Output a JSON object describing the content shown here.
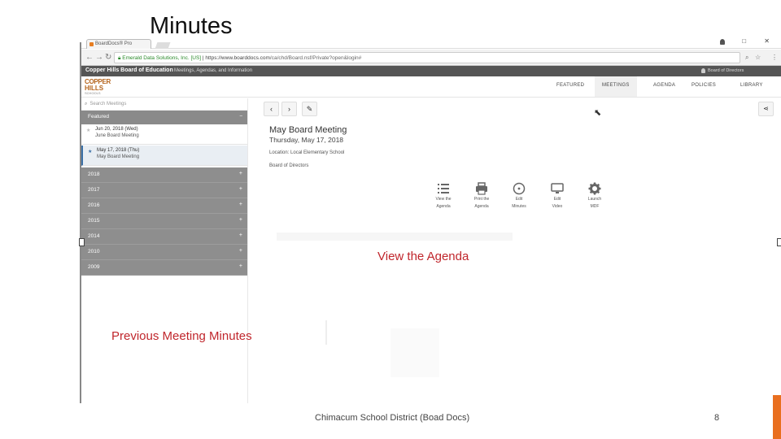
{
  "slide": {
    "title": "Minutes",
    "callout_agenda": "View the Agenda",
    "callout_minutes": "Previous Meeting Minutes",
    "footer": "Chimacum School District (Boad Docs)",
    "page_number": "8",
    "accent_color": "#c0262c",
    "bar_color": "#e96f1f"
  },
  "browser": {
    "tab_label": "BoardDocs® Pro",
    "window_controls": "–  □  ✕",
    "url_secure": "Emerald Data Solutions, Inc. [US]",
    "url_host": "https://www.boarddocs.com",
    "url_path": "/ca/chd/Board.nsf/Private?open&login#"
  },
  "site": {
    "board_title": "Copper Hills Board of Education",
    "subtitle": "Meetings, Agendas, and Information",
    "user_menu": "Board of Directors",
    "logo_line1": "COPPER",
    "logo_line2": "HILLS",
    "logo_line3": "SCHOOLS",
    "nav": [
      "FEATURED",
      "MEETINGS",
      "AGENDA",
      "POLICIES",
      "LIBRARY"
    ]
  },
  "sidebar": {
    "search_placeholder": "Search Meetings",
    "featured_label": "Featured",
    "meetings": [
      {
        "date": "Jun 20, 2018 (Wed)",
        "name": "June Board Meeting",
        "selected": false
      },
      {
        "date": "May 17, 2018 (Thu)",
        "name": "May Board Meeting",
        "selected": true
      }
    ],
    "years": [
      "2018",
      "2017",
      "2016",
      "2015",
      "2014",
      "2010",
      "2009"
    ]
  },
  "meeting": {
    "title": "May Board Meeting",
    "date": "Thursday, May 17, 2018",
    "location": "Location: Local Elementary School",
    "board": "Board of Directors"
  },
  "actions": [
    {
      "line1": "View the",
      "line2": "Agenda",
      "icon": "list-icon"
    },
    {
      "line1": "Print the",
      "line2": "Agenda",
      "icon": "printer-icon"
    },
    {
      "line1": "Edit",
      "line2": "Minutes",
      "icon": "clock-icon"
    },
    {
      "line1": "Edit",
      "line2": "Video",
      "icon": "monitor-icon"
    },
    {
      "line1": "Launch",
      "line2": "MDF",
      "icon": "gear-icon"
    }
  ]
}
